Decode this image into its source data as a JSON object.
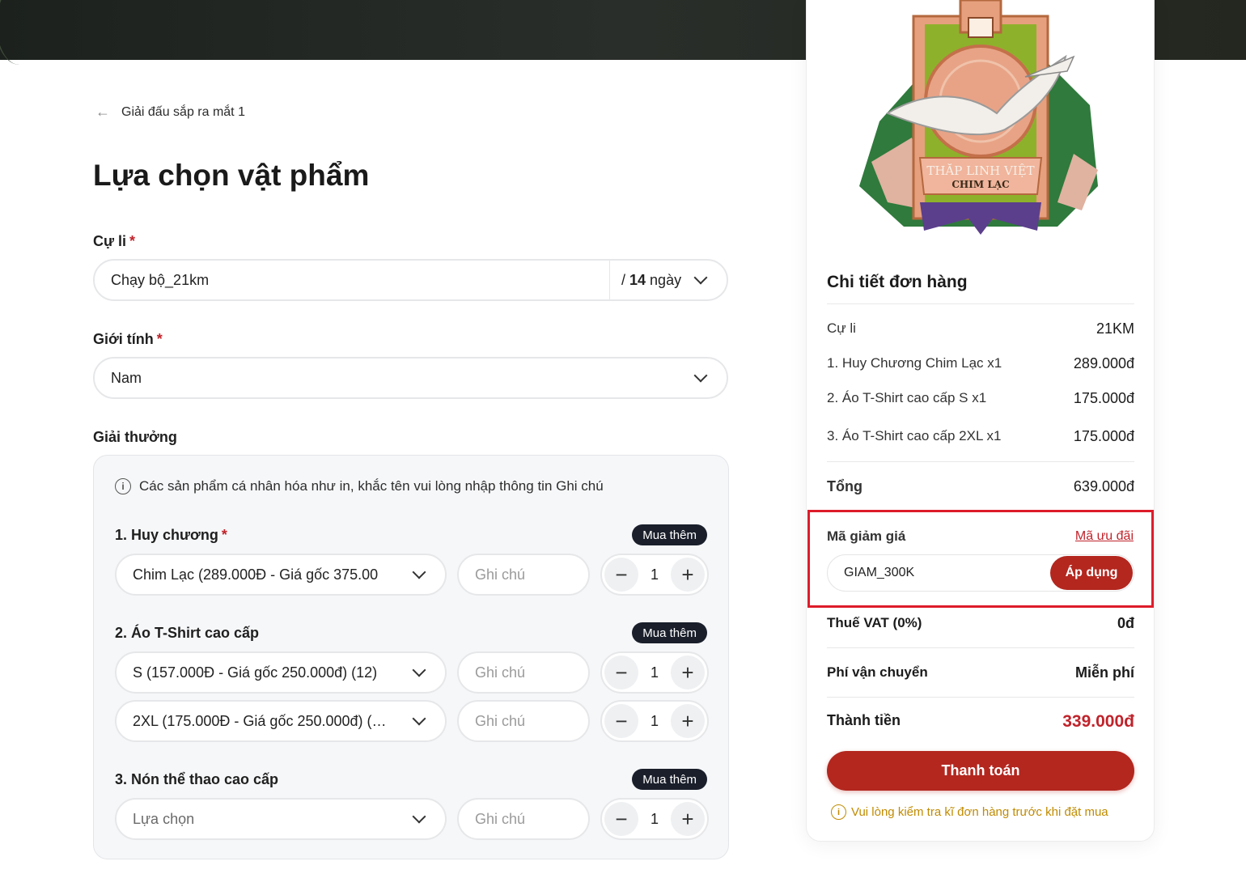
{
  "header": {
    "back_label": "Giải đấu sắp ra mắt 1",
    "page_title": "Lựa chọn vật phẩm"
  },
  "form": {
    "distance": {
      "label": "Cự li",
      "required_mark": "*",
      "value": "Chạy bộ_21km",
      "days_prefix": "/ ",
      "days_number": "14",
      "days_unit": " ngày"
    },
    "gender": {
      "label": "Giới tính",
      "required_mark": "*",
      "value": "Nam"
    },
    "awards": {
      "label": "Giải thưởng",
      "note": "Các sản phẩm cá nhân hóa như in, khắc tên vui lòng nhập thông tin Ghi chú",
      "buy_more_label": "Mua thêm",
      "note_placeholder": "Ghi chú",
      "sections": [
        {
          "title": "1. Huy chương",
          "required_mark": "*",
          "rows": [
            {
              "selected": "Chim Lạc  (289.000Đ - Giá gốc 375.00",
              "qty": "1"
            }
          ]
        },
        {
          "title": "2. Áo T-Shirt cao cấp",
          "rows": [
            {
              "selected": "S (157.000Đ - Giá gốc 250.000đ) (12)",
              "qty": "1"
            },
            {
              "selected": "2XL (175.000Đ - Giá gốc 250.000đ) (…",
              "qty": "1"
            }
          ]
        },
        {
          "title": "3. Nón thể thao cao cấp",
          "rows": [
            {
              "selected": "Lựa chọn",
              "qty": "1"
            }
          ]
        }
      ]
    }
  },
  "order": {
    "title": "Chi tiết đơn hàng",
    "distance_label": "Cự li",
    "distance_value": "21KM",
    "items": [
      {
        "label": "1. Huy Chương Chim Lạc x1",
        "value": "289.000đ"
      },
      {
        "label": "2. Áo T-Shirt cao cấp S x1",
        "value": "175.000đ"
      },
      {
        "label": "3. Áo T-Shirt cao cấp 2XL x1",
        "value": "175.000đ"
      }
    ],
    "subtotal_label": "Tổng",
    "subtotal_value": "639.000đ",
    "discount_label": "Mã giảm giá",
    "promo_link": "Mã ưu đãi",
    "discount_code": "GIAM_300K",
    "apply_label": "Áp dụng",
    "vat_label": "Thuế VAT (0%)",
    "vat_value": "0đ",
    "shipping_label": "Phí vận chuyển",
    "shipping_value": "Miễn phí",
    "total_label": "Thành tiền",
    "total_value": "339.000đ",
    "pay_label": "Thanh toán",
    "warning": "Vui lòng kiểm tra kĩ đơn hàng trước khi đặt mua",
    "medal_text_1": "THĂP LINH VIỆT",
    "medal_text_2": "CHIM LẠC"
  },
  "colors": {
    "accent": "#b3271f",
    "highlight_border": "#dd1c2a",
    "warning": "#c18b00",
    "badge_bg": "#1a1f2b"
  }
}
